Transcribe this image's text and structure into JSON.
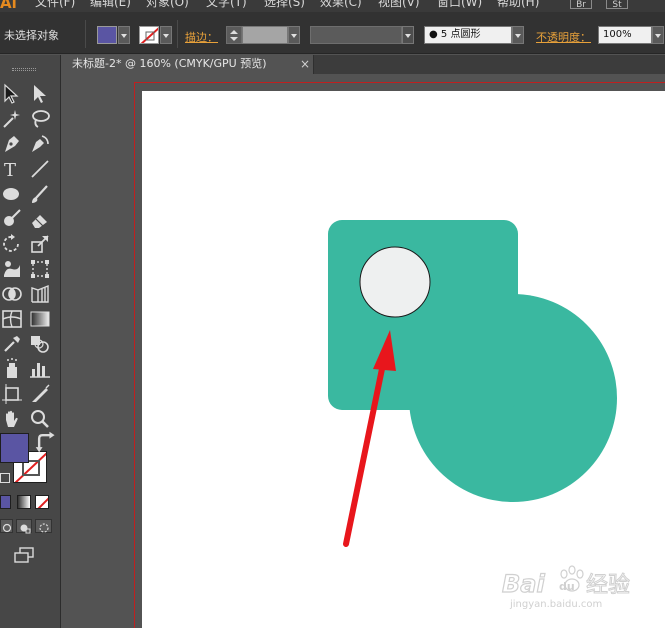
{
  "app": {
    "logo": "Ai"
  },
  "menu": [
    {
      "label": "文件(F)"
    },
    {
      "label": "编辑(E)"
    },
    {
      "label": "对象(O)"
    },
    {
      "label": "文字(T)"
    },
    {
      "label": "选择(S)"
    },
    {
      "label": "效果(C)"
    },
    {
      "label": "视图(V)"
    },
    {
      "label": "窗口(W)"
    },
    {
      "label": "帮助(H)"
    }
  ],
  "app_buttons": [
    {
      "label": "Br"
    },
    {
      "label": "St"
    }
  ],
  "controlbar": {
    "selection_status": "未选择对象",
    "stroke_label": "描边：",
    "brush_value": "5 点圆形",
    "opacity_label": "不透明度：",
    "opacity_value": "100%",
    "fill_color": "#5a55a3"
  },
  "document": {
    "tab_title": "未标题-2* @ 160% (CMYK/GPU 预览)",
    "close_glyph": "×"
  },
  "artwork": {
    "shape_color": "#3ab8a0",
    "circle_color": "#eef0f0",
    "arrow_color": "#e8161c"
  },
  "watermark": {
    "brand": "Bai",
    "paw": "du",
    "suffix": "经验",
    "url": "jingyan.baidu.com"
  },
  "toolbox": {
    "fill_color": "#5a55a3",
    "stroke_color": "#ffffff"
  }
}
